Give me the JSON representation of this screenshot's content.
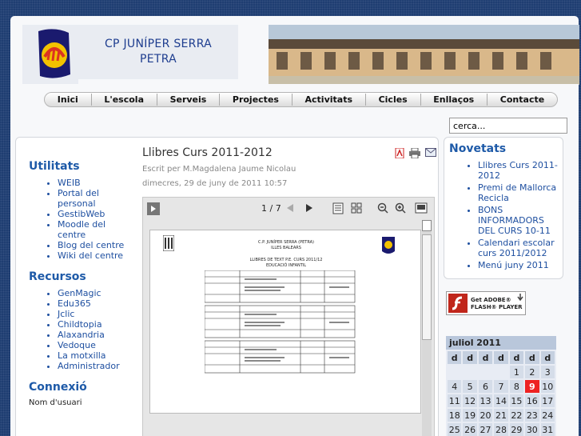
{
  "school": {
    "line1": "CP JUNÍPER SERRA",
    "line2": "PETRA"
  },
  "nav": [
    "Inici",
    "L'escola",
    "Serveis",
    "Projectes",
    "Activitats",
    "Cicles",
    "Enllaços",
    "Contacte"
  ],
  "search": {
    "value": "cerca..."
  },
  "sidebar": {
    "utilitats": {
      "title": "Utilitats",
      "items": [
        "WEIB",
        "Portal del personal",
        "GestibWeb",
        "Moodle del centre",
        "Blog del centre",
        "Wiki del centre"
      ]
    },
    "recursos": {
      "title": "Recursos",
      "items": [
        "GenMagic",
        "Edu365",
        "Jclic",
        "Childtopia",
        "Alaxandria",
        "Vedoque",
        "La motxilla",
        "Administrador"
      ]
    },
    "connexio": {
      "title": "Connexió",
      "user_label": "Nom d'usuari"
    }
  },
  "article": {
    "title": "Llibres Curs 2011-2012",
    "author": "Escrit per M.Magdalena Jaume Nicolau",
    "date": "dimecres, 29 de juny de 2011 10:57"
  },
  "viewer": {
    "page": "1 / 7",
    "doc_title": "C.P. JUNÍPER SERRA (PETRA)",
    "doc_sub": "ILLES BALEARS",
    "doc_heading": "LLIBRES DE TEXT P.E. CURS 2011/12",
    "doc_heading2": "EDUCACIÓ INFANTIL"
  },
  "novetats": {
    "title": "Novetats",
    "items": [
      "Llibres Curs 2011-2012",
      "Premi de Mallorca Recicla",
      "BONS INFORMADORS DEL CURS 10-11",
      "Calendari escolar curs 2011/2012",
      "Menú juny 2011"
    ]
  },
  "flash": {
    "line1": "Get ADOBE®",
    "line2": "FLASH® PLAYER"
  },
  "calendar": {
    "month": "juliol 2011",
    "days": [
      "d",
      "d",
      "d",
      "d",
      "d",
      "d",
      "d"
    ],
    "weeks": [
      [
        "",
        "",
        "",
        "",
        "1",
        "2",
        "3"
      ],
      [
        "4",
        "5",
        "6",
        "7",
        "8",
        "9",
        "10"
      ],
      [
        "11",
        "12",
        "13",
        "14",
        "15",
        "16",
        "17"
      ],
      [
        "18",
        "19",
        "20",
        "21",
        "22",
        "23",
        "24"
      ],
      [
        "25",
        "26",
        "27",
        "28",
        "29",
        "30",
        "31"
      ]
    ],
    "today": "9"
  },
  "colors": {
    "accent": "#1e5aa8",
    "background": "#1f3e72"
  }
}
